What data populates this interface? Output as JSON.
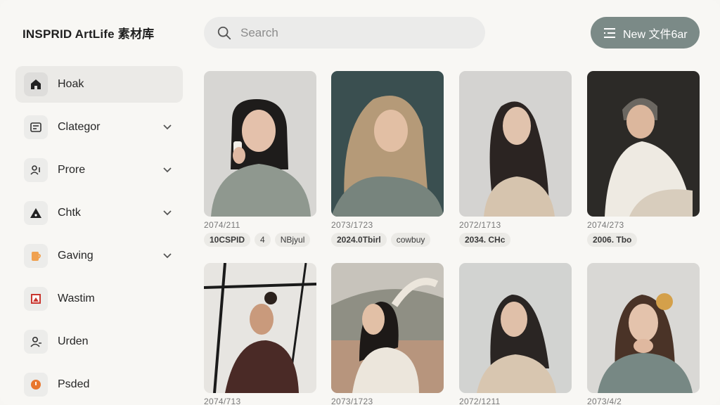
{
  "app": {
    "brand": "INSPRID ArtLife 素材库"
  },
  "search": {
    "placeholder": "Search"
  },
  "new_button": {
    "label": "New 文件6ar"
  },
  "sidebar": {
    "items": [
      {
        "label": "Hoak",
        "icon": "home-icon",
        "active": true,
        "expandable": false
      },
      {
        "label": "Clategor",
        "icon": "category-icon",
        "active": false,
        "expandable": true
      },
      {
        "label": "Prore",
        "icon": "people-icon",
        "active": false,
        "expandable": true
      },
      {
        "label": "Chtk",
        "icon": "triangle-icon",
        "active": false,
        "expandable": true
      },
      {
        "label": "Gaving",
        "icon": "cup-icon",
        "active": false,
        "expandable": true
      },
      {
        "label": "Wastim",
        "icon": "bookmark-icon",
        "active": false,
        "expandable": false
      },
      {
        "label": "Urden",
        "icon": "user-icon",
        "active": false,
        "expandable": false
      },
      {
        "label": "Psded",
        "icon": "clock-icon",
        "active": false,
        "expandable": false
      }
    ]
  },
  "gallery": {
    "cards": [
      {
        "date": "2074/211",
        "tags": [
          "10CSPID",
          "4",
          "NBjyul"
        ],
        "photo": "woman-grey-sweater-phone"
      },
      {
        "date": "2073/1723",
        "tags": [
          "2024.0Tbirl",
          "cowbuy"
        ],
        "photo": "woman-blonde-teal-bg"
      },
      {
        "date": "2072/1713",
        "tags": [
          "2034. CHc"
        ],
        "photo": "woman-wavy-hair-beige"
      },
      {
        "date": "2074/273",
        "tags": [
          "2006. Tbo"
        ],
        "photo": "man-white-shirt-sitting"
      },
      {
        "date": "2074/713",
        "tags": [],
        "photo": "man-bun-dark-sweater"
      },
      {
        "date": "2073/1723",
        "tags": [],
        "photo": "woman-arm-raised-outdoor"
      },
      {
        "date": "2072/1211",
        "tags": [],
        "photo": "woman-wavy-hair-grey"
      },
      {
        "date": "2073/4/2",
        "tags": [],
        "photo": "woman-hair-clip-green-sweater"
      }
    ]
  },
  "colors": {
    "accent_button": "#7b8a87",
    "sidebar_active": "#ebeae7",
    "background": "#f8f7f4"
  }
}
